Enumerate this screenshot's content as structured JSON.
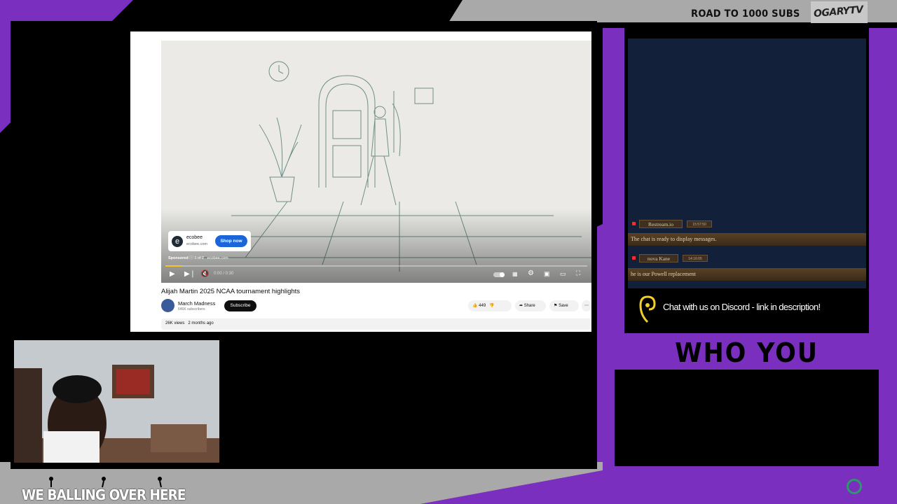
{
  "stream": {
    "goal_text": "ROAD TO 1000 SUBS",
    "brand": "OGARYTV",
    "banner": "WE BALLING OVER HERE",
    "prediction_title": "WHO YOU GOT?"
  },
  "youtube": {
    "ad": {
      "name": "ecobee",
      "url": "ecobee.com",
      "cta": "Shop now",
      "sponsored_label": "Sponsored",
      "ad_count": "1 of 2",
      "domain": "ecobee.com",
      "progress": 0.04
    },
    "player": {
      "time": "0:00 / 0:30"
    },
    "video": {
      "title": "Alijah Martin 2025 NCAA tournament highlights",
      "channel": "March Madness",
      "subscribers": "646K subscribers",
      "subscribe_label": "Subscribe",
      "likes": "449",
      "share_label": "Share",
      "save_label": "Save",
      "views": "26K views",
      "age": "2 months ago"
    }
  },
  "chat": {
    "messages": [
      {
        "author": "Restream.io",
        "time": "15:57:50",
        "text": "The chat is ready to display messages."
      },
      {
        "author": "nova Kane",
        "time": "14:16:05",
        "text": "he is our Powell replacement"
      }
    ],
    "discord_text": "Chat with us on Discord - link in description!"
  },
  "colors": {
    "purple": "#7b2fbf",
    "gray_band": "#a9a9a9",
    "chat_bg": "#13203a",
    "accent_yellow": "#f4c32f",
    "subscribe_btn": "#0f0f0f",
    "shop_btn": "#1a66d8"
  },
  "icons": [
    "play-icon",
    "next-icon",
    "mute-icon",
    "settings-icon",
    "miniplayer-icon",
    "theater-icon",
    "fullscreen-icon",
    "like-icon",
    "dislike-icon",
    "share-icon",
    "save-icon",
    "more-icon",
    "discord-icon",
    "restream-icon"
  ]
}
